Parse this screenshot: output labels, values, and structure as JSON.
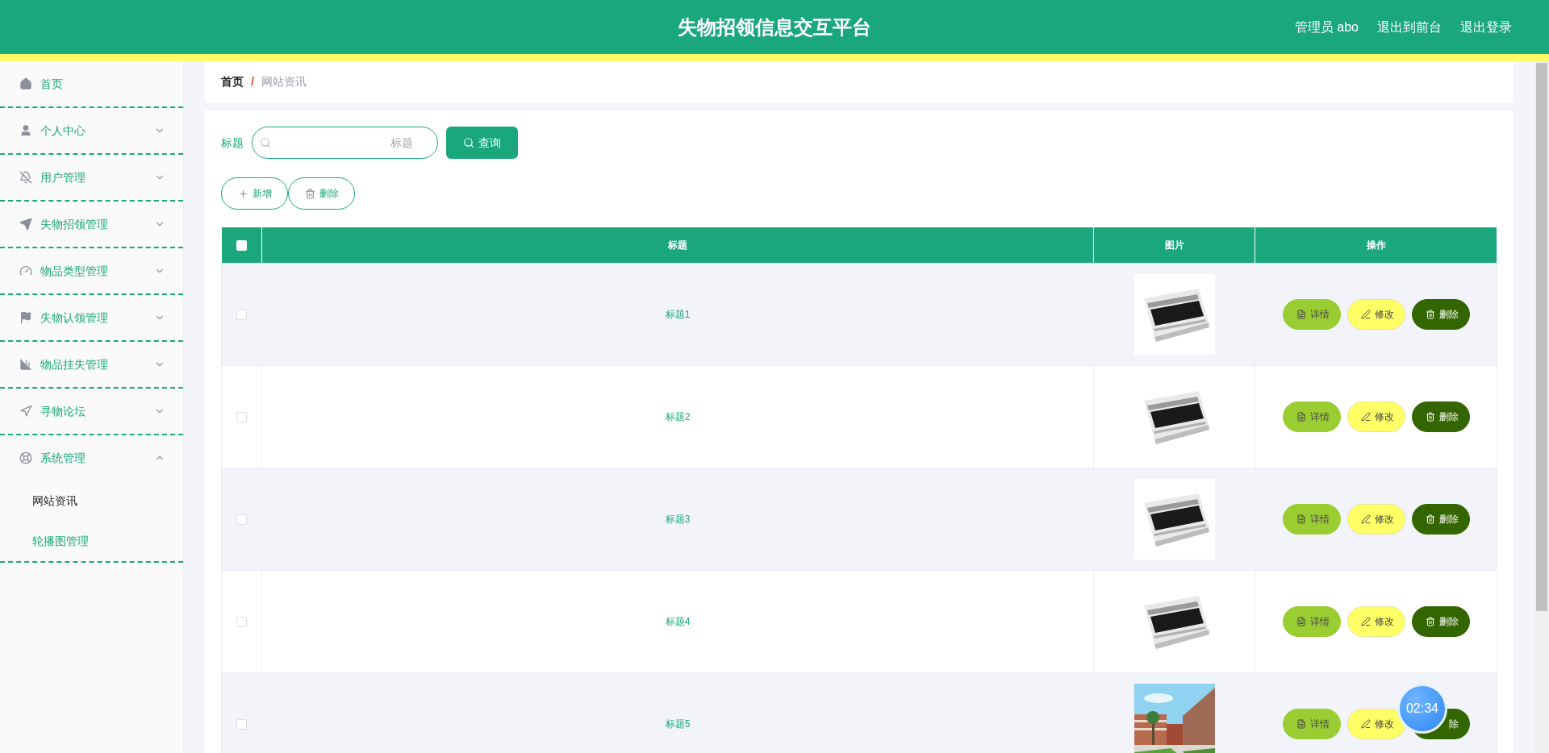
{
  "header": {
    "title": "失物招领信息交互平台",
    "links": [
      "管理员 abo",
      "退出到前台",
      "退出登录"
    ]
  },
  "sidebar": {
    "items": [
      {
        "label": "首页",
        "kind": "link"
      },
      {
        "label": "个人中心",
        "kind": "menu",
        "expanded": false
      },
      {
        "label": "用户管理",
        "kind": "menu",
        "expanded": false
      },
      {
        "label": "失物招领管理",
        "kind": "menu",
        "expanded": false
      },
      {
        "label": "物品类型管理",
        "kind": "menu",
        "expanded": false
      },
      {
        "label": "失物认领管理",
        "kind": "menu",
        "expanded": false
      },
      {
        "label": "物品挂失管理",
        "kind": "menu",
        "expanded": false
      },
      {
        "label": "寻物论坛",
        "kind": "menu",
        "expanded": false
      },
      {
        "label": "系统管理",
        "kind": "menu",
        "expanded": true,
        "children": [
          {
            "label": "网站资讯",
            "selected": true
          },
          {
            "label": "轮播图管理",
            "selected": false
          }
        ]
      }
    ]
  },
  "breadcrumb": {
    "items": [
      "首页",
      "网站资讯"
    ],
    "separator": "/"
  },
  "search": {
    "label": "标题",
    "placeholder": "标题",
    "button": "查询"
  },
  "toolbar": [
    "新增",
    "删除"
  ],
  "table": {
    "columns": [
      "标题",
      "图片",
      "操作"
    ],
    "header_checked": false,
    "rows": [
      {
        "checked": false,
        "title": "标题1",
        "actions": [
          {
            "kind": "detail",
            "label": "详情",
            "icon": true
          },
          {
            "kind": "edit",
            "label": "修改",
            "icon": true
          },
          {
            "kind": "delete",
            "label": "删除",
            "icon": true
          }
        ]
      },
      {
        "checked": false,
        "title": "标题2",
        "actions": [
          {
            "kind": "detail",
            "label": "详情",
            "icon": true
          },
          {
            "kind": "edit",
            "label": "修改",
            "icon": true
          },
          {
            "kind": "delete",
            "label": "删除",
            "icon": true
          }
        ]
      },
      {
        "checked": false,
        "title": "标题3",
        "actions": [
          {
            "kind": "detail",
            "label": "详情",
            "icon": true
          },
          {
            "kind": "edit",
            "label": "修改",
            "icon": true
          },
          {
            "kind": "delete",
            "label": "删除",
            "icon": true
          }
        ]
      },
      {
        "checked": false,
        "title": "标题4",
        "actions": [
          {
            "kind": "detail",
            "label": "详情",
            "icon": true
          },
          {
            "kind": "edit",
            "label": "修改",
            "icon": true
          },
          {
            "kind": "delete",
            "label": "删除",
            "icon": true
          }
        ]
      },
      {
        "checked": false,
        "title": "标题5",
        "actions": [
          {
            "kind": "detail",
            "label": "详情",
            "icon": true
          },
          {
            "kind": "edit",
            "label": "修改",
            "icon": true
          },
          {
            "kind": "delete",
            "label": "除",
            "icon": false
          }
        ]
      }
    ]
  },
  "timer": "02:34"
}
